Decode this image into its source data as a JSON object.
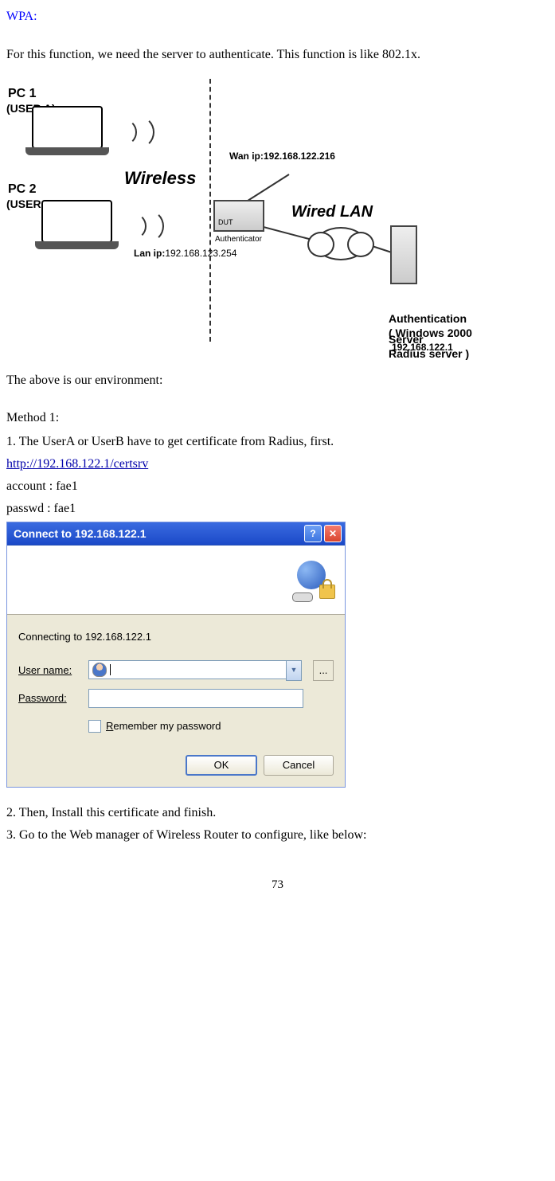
{
  "heading": "WPA:",
  "intro": "For this function, we need the server to authenticate. This function is like 802.1x.",
  "diagram": {
    "pc1": "PC 1",
    "userA": "(USER A)",
    "pc2": "PC 2",
    "userB": "(USER B)",
    "wireless": "Wireless",
    "wired": "Wired  LAN",
    "wan_label": "Wan ip:",
    "wan_ip": "192.168.122.216",
    "lan_label": "Lan ip:",
    "lan_ip": "192.168.123.254",
    "dut": "DUT",
    "authenticator": "Authenticator",
    "server_line1": "Authentication Server",
    "server_line2": "( Windows 2000 Radius server )",
    "server_ip": "192.168.122.1"
  },
  "env_line": "The above is our environment:",
  "method_label": "Method 1:",
  "step1": "1. The UserA or UserB have to get certificate from Radius, first.",
  "cert_url": "http://192.168.122.1/certsrv",
  "account_line": "account : fae1",
  "passwd_line": "passwd : fae1",
  "dialog": {
    "title": "Connect to 192.168.122.1",
    "connecting": "Connecting to 192.168.122.1",
    "username_label_pre": "",
    "username_u": "U",
    "username_label_post": "ser name:",
    "password_u": "P",
    "password_label_post": "assword:",
    "remember_u": "R",
    "remember_post": "emember my password",
    "ok": "OK",
    "cancel": "Cancel",
    "browse": "..."
  },
  "step2": "2. Then, Install this certificate and finish.",
  "step3": "3. Go to the Web manager of Wireless Router to configure, like below:",
  "page": "73"
}
